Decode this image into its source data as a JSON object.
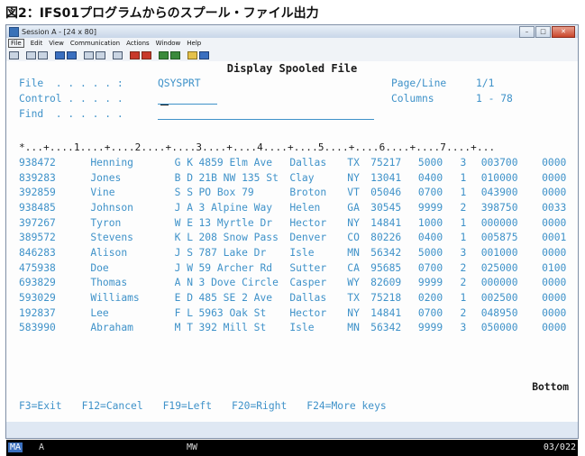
{
  "caption": "図2：IFS01プログラムからのスプール・ファイル出力",
  "window": {
    "title": "Session A - [24 x 80]",
    "buttons": {
      "minimize": "–",
      "maximize": "□",
      "close": "✕"
    }
  },
  "menu": [
    "File",
    "Edit",
    "View",
    "Communication",
    "Actions",
    "Window",
    "Help"
  ],
  "screen": {
    "heading": "Display Spooled File",
    "file_label": "File  . . . . . :",
    "file_value": "QSYSPRT",
    "control_label": "Control . . . . .",
    "find_label": "Find  . . . . . .",
    "pageline_label": "Page/Line",
    "pageline_value": "1/1",
    "columns_label": "Columns",
    "columns_value": "1 - 78",
    "ruler": "*...+....1....+....2....+....3....+....4....+....5....+....6....+....7....+...",
    "rows": [
      [
        "938472",
        "Henning",
        "G K",
        "4859 Elm Ave",
        "Dallas",
        "TX",
        "75217",
        "5000",
        "3",
        "003700",
        "0000"
      ],
      [
        "839283",
        "Jones",
        "B D",
        "21B NW 135 St",
        "Clay",
        "NY",
        "13041",
        "0400",
        "1",
        "010000",
        "0000"
      ],
      [
        "392859",
        "Vine",
        "S S",
        "PO Box 79",
        "Broton",
        "VT",
        "05046",
        "0700",
        "1",
        "043900",
        "0000"
      ],
      [
        "938485",
        "Johnson",
        "J A",
        "3 Alpine Way",
        "Helen",
        "GA",
        "30545",
        "9999",
        "2",
        "398750",
        "0033"
      ],
      [
        "397267",
        "Tyron",
        "W E",
        "13 Myrtle Dr",
        "Hector",
        "NY",
        "14841",
        "1000",
        "1",
        "000000",
        "0000"
      ],
      [
        "389572",
        "Stevens",
        "K L",
        "208 Snow Pass",
        "Denver",
        "CO",
        "80226",
        "0400",
        "1",
        "005875",
        "0001"
      ],
      [
        "846283",
        "Alison",
        "J S",
        "787 Lake Dr",
        "Isle",
        "MN",
        "56342",
        "5000",
        "3",
        "001000",
        "0000"
      ],
      [
        "475938",
        "Doe",
        "J W",
        "59 Archer Rd",
        "Sutter",
        "CA",
        "95685",
        "0700",
        "2",
        "025000",
        "0100"
      ],
      [
        "693829",
        "Thomas",
        "A N",
        "3 Dove Circle",
        "Casper",
        "WY",
        "82609",
        "9999",
        "2",
        "000000",
        "0000"
      ],
      [
        "593029",
        "Williams",
        "E D",
        "485 SE 2 Ave",
        "Dallas",
        "TX",
        "75218",
        "0200",
        "1",
        "002500",
        "0000"
      ],
      [
        "192837",
        "Lee",
        "F L",
        "5963 Oak St",
        "Hector",
        "NY",
        "14841",
        "0700",
        "2",
        "048950",
        "0000"
      ],
      [
        "583990",
        "Abraham",
        "M T",
        "392 Mill St",
        "Isle",
        "MN",
        "56342",
        "9999",
        "3",
        "050000",
        "0000"
      ]
    ],
    "bottom_label": "Bottom",
    "function_keys": [
      "F3=Exit",
      "F12=Cancel",
      "F19=Left",
      "F20=Right",
      "F24=More keys"
    ]
  },
  "status": {
    "mode": "MA",
    "indicator": "A",
    "mw": "MW",
    "position": "03/022"
  }
}
